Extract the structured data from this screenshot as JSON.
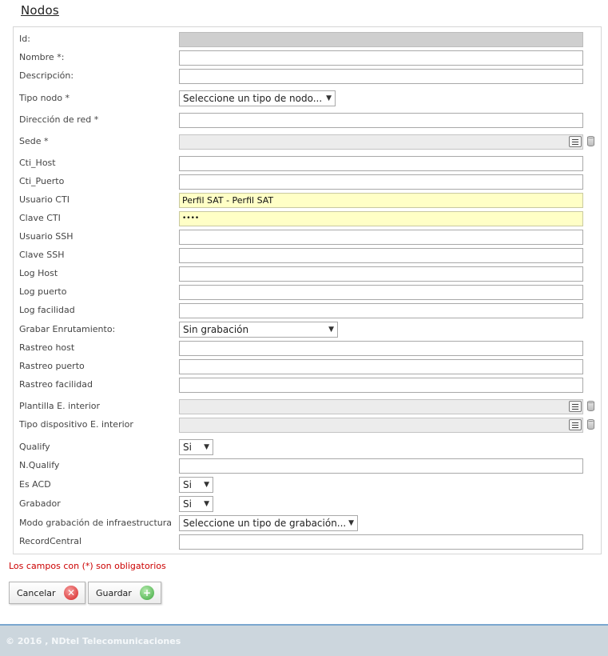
{
  "page": {
    "title": "Nodos"
  },
  "fields": {
    "id": {
      "label": "Id:",
      "value": ""
    },
    "nombre": {
      "label": "Nombre *:",
      "value": ""
    },
    "descripcion": {
      "label": "Descripción:",
      "value": ""
    },
    "tipo_nodo": {
      "label": "Tipo nodo *",
      "selected": "Seleccione un tipo de nodo..."
    },
    "direccion_red": {
      "label": "Dirección de red *",
      "value": ""
    },
    "sede": {
      "label": "Sede *",
      "value": ""
    },
    "cti_host": {
      "label": "Cti_Host",
      "value": ""
    },
    "cti_puerto": {
      "label": "Cti_Puerto",
      "value": ""
    },
    "usuario_cti": {
      "label": "Usuario CTI",
      "value": "Perfil SAT - Perfil SAT"
    },
    "clave_cti": {
      "label": "Clave CTI",
      "value": "••••"
    },
    "usuario_ssh": {
      "label": "Usuario SSH",
      "value": ""
    },
    "clave_ssh": {
      "label": "Clave SSH",
      "value": ""
    },
    "log_host": {
      "label": "Log Host",
      "value": ""
    },
    "log_puerto": {
      "label": "Log puerto",
      "value": ""
    },
    "log_facilidad": {
      "label": "Log facilidad",
      "value": ""
    },
    "grabar_enrutamiento": {
      "label": "Grabar Enrutamiento:",
      "selected": "Sin grabación"
    },
    "rastreo_host": {
      "label": "Rastreo host",
      "value": ""
    },
    "rastreo_puerto": {
      "label": "Rastreo puerto",
      "value": ""
    },
    "rastreo_facilidad": {
      "label": "Rastreo facilidad",
      "value": ""
    },
    "plantilla_ei": {
      "label": "Plantilla E. interior",
      "value": ""
    },
    "tipo_dispositivo_ei": {
      "label": "Tipo dispositivo E. interior",
      "value": ""
    },
    "qualify": {
      "label": "Qualify",
      "selected": "Si"
    },
    "n_qualify": {
      "label": "N.Qualify",
      "value": ""
    },
    "es_acd": {
      "label": "Es ACD",
      "selected": "Si"
    },
    "grabador": {
      "label": "Grabador",
      "selected": "Si"
    },
    "modo_grabacion": {
      "label": "Modo grabación de infraestructura",
      "selected": "Seleccione un tipo de grabación..."
    },
    "record_central": {
      "label": "RecordCentral",
      "value": ""
    }
  },
  "required_note": "Los campos con (*) son obligatorios",
  "buttons": {
    "cancel": "Cancelar",
    "save": "Guardar"
  },
  "footer": {
    "text": "© 2016 , NDtel Telecomunicaciones"
  },
  "colors": {
    "required": "#cc0000",
    "highlight": "#ffffc6",
    "footer_bg": "#ccd6dd"
  }
}
